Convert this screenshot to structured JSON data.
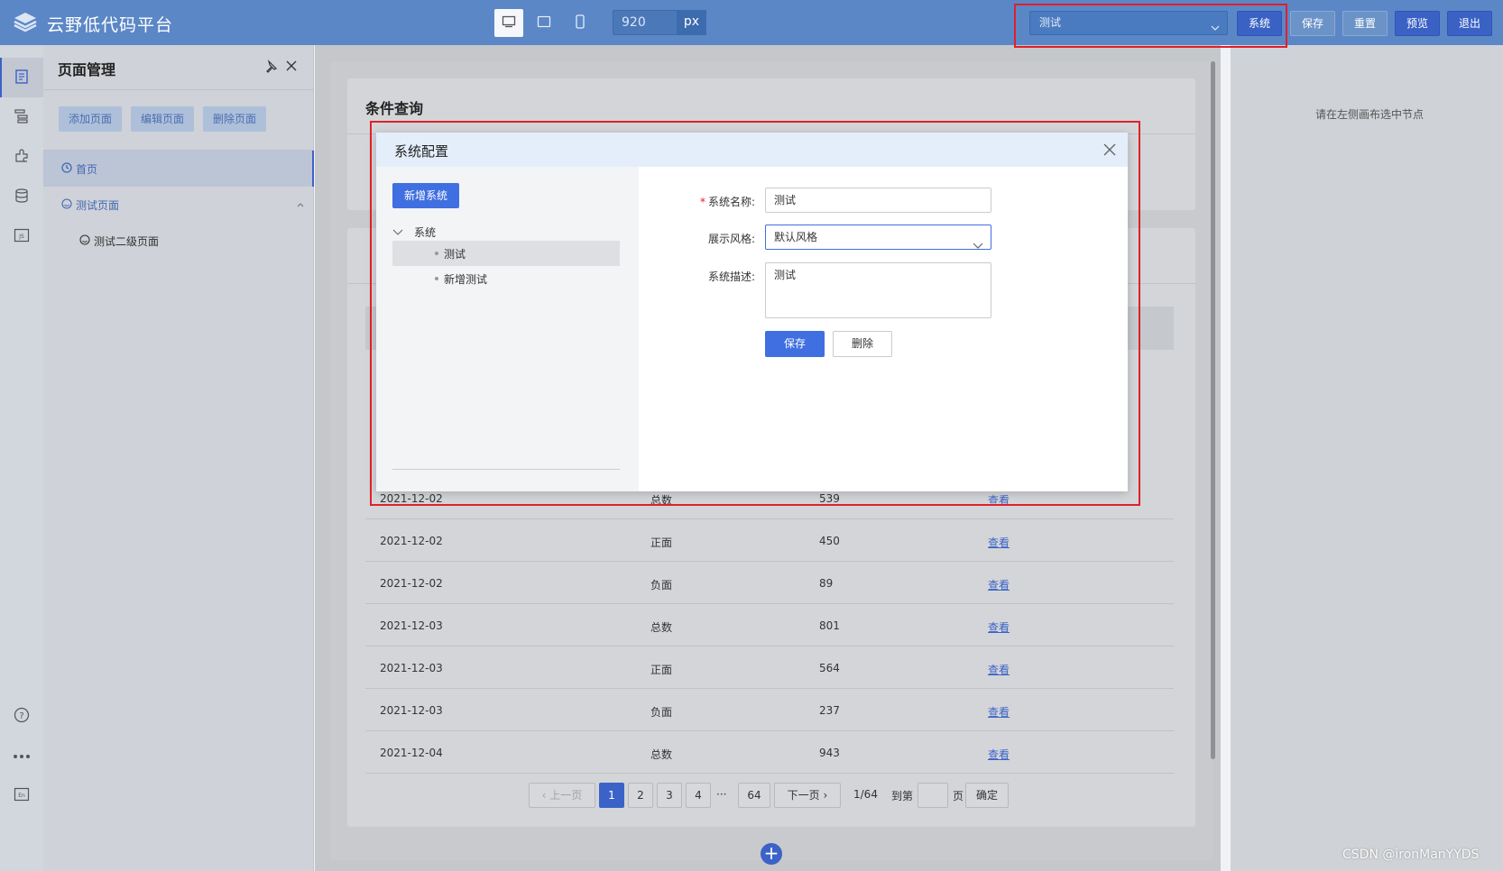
{
  "header": {
    "app_title": "云野低代码平台",
    "width_value": "920",
    "width_unit": "px",
    "system_select_value": "测试",
    "buttons": {
      "system": "系统",
      "save": "保存",
      "reset": "重置",
      "preview": "预览",
      "exit": "退出"
    },
    "device_icons": [
      "desktop-icon",
      "tablet-icon",
      "mobile-icon"
    ],
    "active_device": "desktop"
  },
  "iconbar": {
    "top_icons": [
      "page-icon",
      "tree-structure-icon",
      "component-icon",
      "database-icon",
      "js-icon"
    ],
    "bottom_icons": [
      "help-icon",
      "more-icon",
      "language-icon"
    ]
  },
  "page_panel": {
    "title": "页面管理",
    "buttons": {
      "add": "添加页面",
      "edit": "编辑页面",
      "delete": "删除页面"
    },
    "tree": {
      "home": "首页",
      "test": "测试页面",
      "sub": "测试二级页面"
    }
  },
  "canvas": {
    "card1_title": "条件查询",
    "rows": [
      {
        "date": "2021-12-02",
        "type": "总数",
        "value": "539",
        "action": "查看"
      },
      {
        "date": "2021-12-02",
        "type": "正面",
        "value": "450",
        "action": "查看"
      },
      {
        "date": "2021-12-02",
        "type": "负面",
        "value": "89",
        "action": "查看"
      },
      {
        "date": "2021-12-03",
        "type": "总数",
        "value": "801",
        "action": "查看"
      },
      {
        "date": "2021-12-03",
        "type": "正面",
        "value": "564",
        "action": "查看"
      },
      {
        "date": "2021-12-03",
        "type": "负面",
        "value": "237",
        "action": "查看"
      },
      {
        "date": "2021-12-04",
        "type": "总数",
        "value": "943",
        "action": "查看"
      }
    ],
    "pager": {
      "prev": "上一页",
      "pages": [
        "1",
        "2",
        "3",
        "4"
      ],
      "ellipsis": "···",
      "last": "64",
      "next": "下一页",
      "total": "1/64",
      "goto": "到第",
      "page_unit": "页",
      "confirm": "确定",
      "current": 1
    }
  },
  "right_panel": {
    "hint": "请在左侧画布选中节点"
  },
  "modal": {
    "title": "系统配置",
    "add_button": "新增系统",
    "tree_root": "系统",
    "tree_nodes": [
      "测试",
      "新增测试"
    ],
    "selected_node": "测试",
    "form": {
      "name_label": "系统名称:",
      "name_value": "测试",
      "style_label": "展示风格:",
      "style_value": "默认风格",
      "desc_label": "系统描述:",
      "desc_value": "测试",
      "required_mark": "*"
    },
    "save_button": "保存",
    "delete_button": "删除"
  },
  "watermark": "CSDN @ironManYYDS",
  "colors": {
    "header_bg": "#5b87c7",
    "accent": "#3f6fe0",
    "highlight": "#e0202a"
  }
}
